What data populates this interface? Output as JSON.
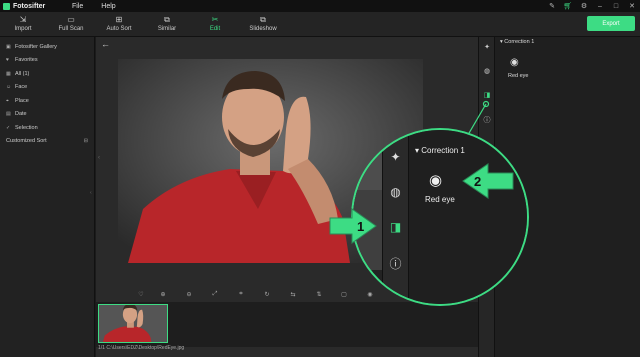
{
  "app": {
    "name": "Fotosifter",
    "menus": [
      "File",
      "Help"
    ]
  },
  "titlebar": {
    "icons": [
      "tools-icon",
      "cart-icon",
      "settings-icon",
      "minimize-icon",
      "maximize-icon",
      "close-icon"
    ]
  },
  "toolbar": {
    "tools": [
      {
        "label": "Import",
        "icon": "import-icon"
      },
      {
        "label": "Full Scan",
        "icon": "full-scan-icon"
      },
      {
        "label": "Auto Sort",
        "icon": "auto-sort-icon"
      },
      {
        "label": "Similar",
        "icon": "similar-icon"
      },
      {
        "label": "Edit",
        "icon": "edit-icon",
        "active": true
      },
      {
        "label": "Slideshow",
        "icon": "slideshow-icon"
      }
    ],
    "export_label": "Export"
  },
  "sidebar": {
    "items": [
      {
        "label": "Fotosifter Gallery",
        "icon": "gallery-icon"
      },
      {
        "label": "Favorites",
        "icon": "heart-icon"
      },
      {
        "label": "All (1)",
        "icon": "grid-icon"
      },
      {
        "label": "Face",
        "icon": "face-icon"
      },
      {
        "label": "Place",
        "icon": "place-icon"
      },
      {
        "label": "Date",
        "icon": "calendar-icon"
      },
      {
        "label": "Selection",
        "icon": "selection-icon"
      }
    ],
    "customized_sort": "Customized Sort"
  },
  "viewer": {
    "bottom_tools": [
      "favorite-icon",
      "zoom-in-icon",
      "zoom-out-icon",
      "fit-icon",
      "crop-icon",
      "rotate-icon",
      "flip-horizontal-icon",
      "flip-vertical-icon",
      "resize-icon",
      "view-icon",
      "compare-icon"
    ],
    "file_index": "1/1",
    "file_path": "C:\\Users\\EDZ\\Desktop\\RedEye.jpg"
  },
  "right_panel": {
    "tool_icons": [
      "retouch-icon",
      "color-icon",
      "correction-icon",
      "info-icon"
    ],
    "section_title": "Correction 1",
    "tool_label": "Red eye",
    "tool_icon": "red-eye-icon"
  },
  "callout": {
    "section_title": "Correction 1",
    "tool_label": "Red eye",
    "step_1": "1",
    "step_2": "2"
  },
  "colors": {
    "accent": "#3ddc84",
    "shirt": "#b8262a",
    "background": "#1b1b1b"
  }
}
